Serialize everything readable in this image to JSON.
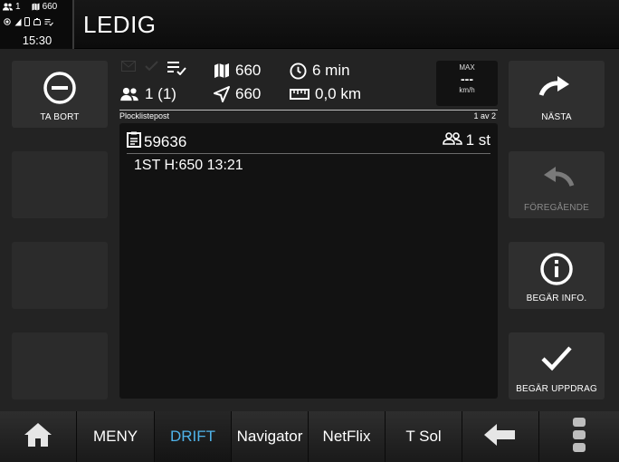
{
  "status": {
    "passengers": "1",
    "vehicle_number": "660",
    "time": "15:30"
  },
  "header": {
    "title": "LEDIG"
  },
  "side_buttons": {
    "left": [
      {
        "label": "TA BORT",
        "icon": "minus-circle-icon",
        "enabled": true
      },
      {
        "label": "",
        "enabled": false
      },
      {
        "label": "",
        "enabled": false
      },
      {
        "label": "",
        "enabled": false
      }
    ],
    "right": [
      {
        "label": "NÄSTA",
        "icon": "redo-arrow-icon",
        "enabled": true
      },
      {
        "label": "FÖREGÅENDE",
        "icon": "undo-arrow-icon",
        "enabled": false
      },
      {
        "label": "BEGÄR INFO.",
        "icon": "info-circle-icon",
        "enabled": true
      },
      {
        "label": "BEGÄR UPPDRAG",
        "icon": "checkmark-icon",
        "enabled": true
      }
    ]
  },
  "info": {
    "map_value": "660",
    "time_value": "6 min",
    "persons_value": "1 (1)",
    "navigation_value": "660",
    "distance_value": "0,0 km"
  },
  "speed": {
    "max_label": "MAX",
    "value": "---",
    "unit": "km/h"
  },
  "list": {
    "title": "Plocklistepost",
    "position": "1 av 2",
    "order_id": "59636",
    "count": "1 st",
    "detail": "1ST H:650 13:21"
  },
  "bottom_nav": {
    "items": [
      "MENY",
      "DRIFT",
      "Navigator",
      "NetFlix",
      "T Sol"
    ],
    "active": "DRIFT"
  },
  "colors": {
    "accent": "#4fb3ea",
    "background": "#232323",
    "panel": "#121212"
  }
}
